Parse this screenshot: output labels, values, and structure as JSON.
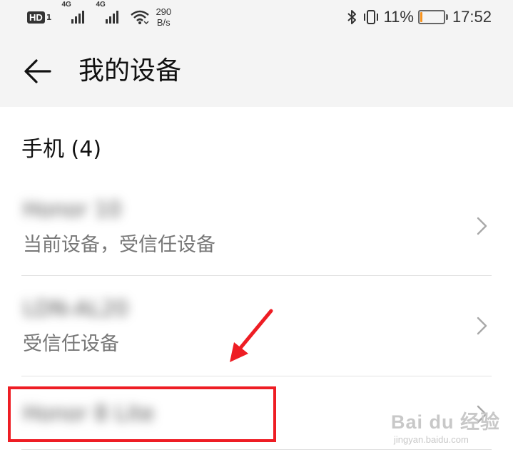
{
  "status_bar": {
    "hd_label": "HD",
    "sim_label": "1",
    "network_label_1": "4G",
    "network_label_2": "4G",
    "speed_value": "290",
    "speed_unit": "B/s",
    "battery_percent": "11%",
    "battery_level": 0.11,
    "battery_color": "#f7931e",
    "time": "17:52"
  },
  "header": {
    "title": "我的设备",
    "back_icon": "back-arrow-icon"
  },
  "section": {
    "title": "手机 (4)"
  },
  "devices": [
    {
      "name": "Honor 10",
      "status": "当前设备，受信任设备"
    },
    {
      "name": "LDN-AL20",
      "status": "受信任设备"
    },
    {
      "name": "Honor 8 Lite",
      "status": ""
    }
  ],
  "annotations": {
    "highlight_color": "#ee1d24",
    "arrow_color": "#ee1d24"
  },
  "watermark": {
    "brand": "Bai du 经验",
    "url": "jingyan.baidu.com"
  }
}
